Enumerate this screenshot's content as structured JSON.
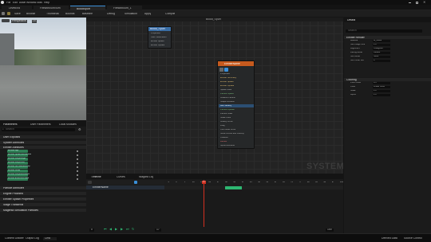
{
  "menu": {
    "items": [
      "File",
      "Edit",
      "Asset",
      "Window",
      "Tools",
      "Help"
    ]
  },
  "tabs": [
    "LevelEnd",
    "FireworkSim/Sim",
    "BloodSpurt",
    "FireworkSim_1"
  ],
  "toolbar": {
    "items": [
      "Save",
      "Browse",
      "Thumbnail",
      "Bounds",
      "Baseline",
      "Debug",
      "Simulation",
      "Apply",
      "Compile"
    ]
  },
  "preview": {
    "label": "Perspective",
    "lit": "Lit"
  },
  "params": {
    "tabs": [
      "Parameters",
      "User Parameters",
      "Local Modules"
    ],
    "search_placeholder": "Search",
    "sections": [
      "User Exposed",
      "System Attributes",
      "Emitter Attributes",
      "Particle Attributes",
      "Engine Provided",
      "Emitter Spawn Properties",
      "Stage Transients",
      "Magenta Simulation Particles"
    ],
    "emitter_rows": [
      "Emitter.Age",
      "Emitter.SpawnRemainder",
      "Emitter.LoopedAge",
      "Emitter.LoopCount",
      "Emitter.NormalizedLoop",
      "Emitter.Scale",
      "Emitter.LoopedDuration",
      "Emitter.ExecutionState"
    ]
  },
  "graph": {
    "title": "Blood_Spurt",
    "watermark": "SYSTEM",
    "system_node": {
      "title": "Blood_Spurt",
      "rows": [
        "Properties",
        "User Parameters",
        "Emitter Spawn",
        "Emitter Update"
      ]
    },
    "emitter_node": {
      "title": "EmitterName",
      "rows": [
        "Properties",
        "Emitter Summary",
        "Emitter Spawn",
        "Emitter Update",
        "Spawn Rate",
        "Particle Spawn",
        "Initialize Particle",
        "Shape Location",
        "Add Velocity",
        "Particle Update",
        "Particle State",
        "Scale Color",
        "Gravity Force",
        "Drag",
        "Curl Noise Force",
        "Solve Forces and Velocity",
        "Collision",
        "Render",
        "Sprite Renderer"
      ]
    }
  },
  "timeline": {
    "tabs": [
      "Timeline",
      "Curves",
      "Niagara Log"
    ],
    "track": "EmitterName",
    "frame_start": "0",
    "frame_current": "17",
    "frame_end": "100",
    "ticks": [
      "-5",
      "0",
      "5",
      "10",
      "15",
      "20",
      "25",
      "30",
      "35",
      "40",
      "45",
      "50",
      "55",
      "60",
      "65",
      "70",
      "75",
      "80",
      "85",
      "90",
      "95",
      "100"
    ],
    "playhead_label": "17"
  },
  "details": {
    "tab": "Details",
    "search_placeholder": "Search",
    "sections": [
      "Emitter Render",
      "Coloring"
    ],
    "rows": [
      {
        "label": "Material",
        "value": "M_Blood"
      },
      {
        "label": "Sub Image Size",
        "value": "1.0"
      },
      {
        "label": "Alignment",
        "value": "Unaligned"
      },
      {
        "label": "Facing Mode",
        "value": "Default"
      },
      {
        "label": "Sort Mode",
        "value": "None"
      },
      {
        "label": "Sort Order Hint",
        "value": "0"
      },
      {
        "label": "Pivot Offset",
        "value": "0.5"
      },
      {
        "label": "Color",
        "value": "Linear Color"
      },
      {
        "label": "Scale",
        "value": "1.0"
      },
      {
        "label": "Alpha",
        "value": "1.0"
      }
    ]
  },
  "status": {
    "items": [
      "Content Drawer",
      "Output Log",
      "Cmd"
    ],
    "right": [
      "Derived Data",
      "Source Control"
    ]
  },
  "colors": {
    "accent": "#3a8fd9",
    "emitter_header": "#c65a1e",
    "emitter_green": "#2f7e55",
    "bar": "#2eb872",
    "playhead": "#d4301f"
  }
}
